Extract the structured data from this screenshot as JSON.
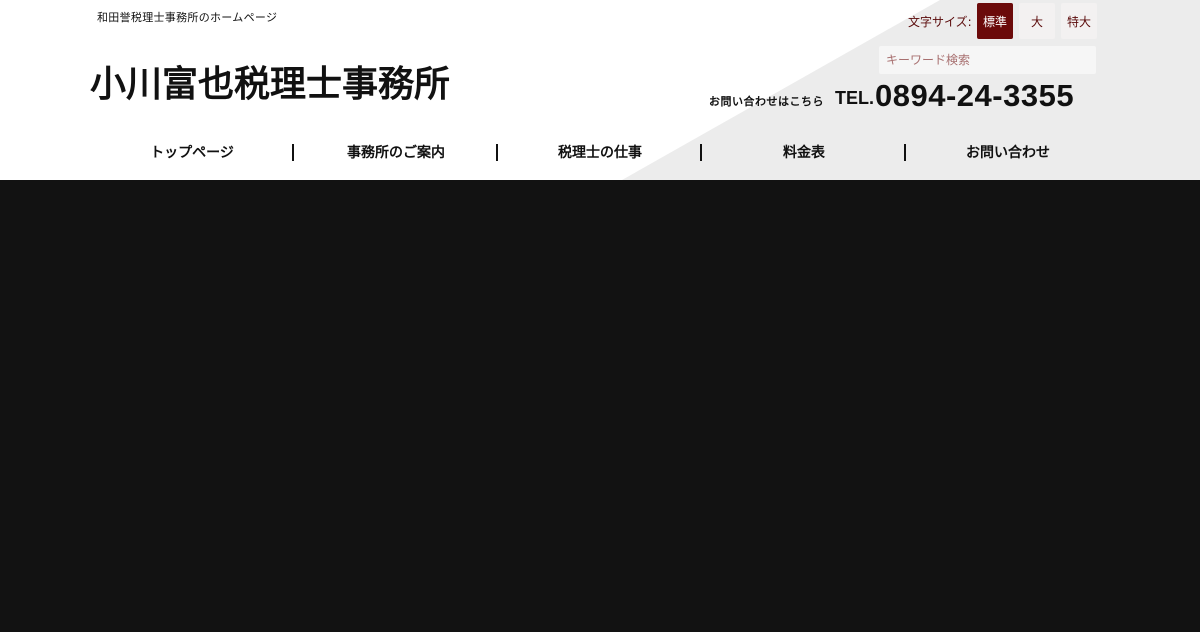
{
  "header": {
    "tagline": "和田誉税理士事務所のホームページ",
    "site_title": "小川富也税理士事務所"
  },
  "font_size": {
    "label": "文字サイズ:",
    "options": [
      {
        "label": "標準",
        "selected": true
      },
      {
        "label": "大",
        "selected": false
      },
      {
        "label": "特大",
        "selected": false
      }
    ]
  },
  "search": {
    "placeholder": "キーワード検索",
    "value": ""
  },
  "contact": {
    "lead": "お問い合わせはこちら",
    "tel_prefix": "TEL.",
    "number": "0894-24-3355"
  },
  "nav": {
    "items": [
      {
        "label": "トップページ"
      },
      {
        "label": "事務所のご案内"
      },
      {
        "label": "税理士の仕事"
      },
      {
        "label": "料金表"
      },
      {
        "label": "お問い合わせ"
      }
    ]
  },
  "colors": {
    "accent": "#6b0a0a",
    "accent_text": "#5a0a0a",
    "header_bg": "#ffffff",
    "header_diagonal": "#ececec",
    "hero_bg": "#121212",
    "text": "#111111"
  }
}
